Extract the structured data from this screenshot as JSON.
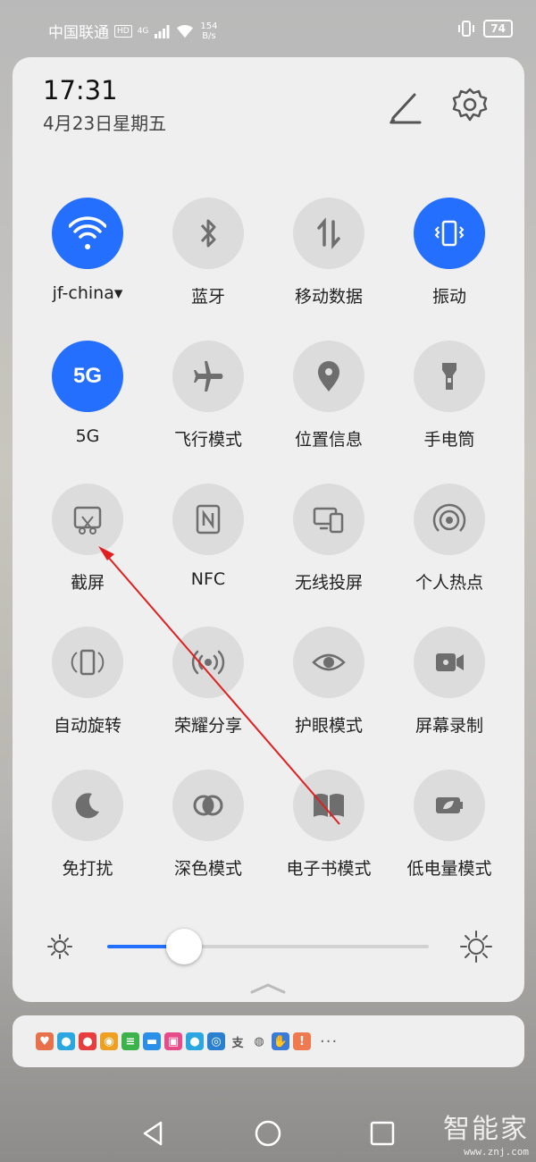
{
  "status_bar": {
    "carrier": "中国联通",
    "hd": "HD",
    "network_type": "4G",
    "net_speed_value": "154",
    "net_speed_unit": "B/s",
    "battery": "74"
  },
  "header": {
    "time": "17:31",
    "date": "4月23日星期五",
    "edit_icon": "pencil-icon",
    "settings_icon": "gear-icon"
  },
  "tiles": [
    {
      "label": "jf-china▾",
      "icon": "wifi-icon",
      "active": true
    },
    {
      "label": "蓝牙",
      "icon": "bluetooth-icon",
      "active": false
    },
    {
      "label": "移动数据",
      "icon": "mobile-data-icon",
      "active": false
    },
    {
      "label": "振动",
      "icon": "vibrate-icon",
      "active": true
    },
    {
      "label": "5G",
      "icon": "5g-icon",
      "icon_text": "5G",
      "active": true
    },
    {
      "label": "飞行模式",
      "icon": "airplane-icon",
      "active": false
    },
    {
      "label": "位置信息",
      "icon": "location-icon",
      "active": false
    },
    {
      "label": "手电筒",
      "icon": "flashlight-icon",
      "active": false
    },
    {
      "label": "截屏",
      "icon": "screenshot-icon",
      "active": false
    },
    {
      "label": "NFC",
      "icon": "nfc-icon",
      "active": false
    },
    {
      "label": "无线投屏",
      "icon": "wireless-projection-icon",
      "active": false
    },
    {
      "label": "个人热点",
      "icon": "hotspot-icon",
      "active": false
    },
    {
      "label": "自动旋转",
      "icon": "auto-rotate-icon",
      "active": false
    },
    {
      "label": "荣耀分享",
      "icon": "honor-share-icon",
      "active": false
    },
    {
      "label": "护眼模式",
      "icon": "eye-comfort-icon",
      "active": false
    },
    {
      "label": "屏幕录制",
      "icon": "screen-record-icon",
      "active": false
    },
    {
      "label": "免打扰",
      "icon": "moon-icon",
      "active": false
    },
    {
      "label": "深色模式",
      "icon": "dark-mode-icon",
      "active": false
    },
    {
      "label": "电子书模式",
      "icon": "ebook-icon",
      "active": false
    },
    {
      "label": "低电量模式",
      "icon": "low-power-icon",
      "active": false
    }
  ],
  "brightness": {
    "level": 0.24
  },
  "colors": {
    "accent": "#256fff",
    "tile_inactive": "#dcdcdc",
    "icon_gray": "#6e6e6e",
    "annotation": "#e02020"
  },
  "notification_icons": [
    "health-icon",
    "browser-icon",
    "app-icon",
    "weibo-icon",
    "app-icon",
    "screen-icon",
    "app-icon",
    "qq-icon",
    "safari-icon",
    "alipay-icon",
    "wechat-icon",
    "hand-icon",
    "cloud-alert-icon"
  ],
  "more_indicator": "···",
  "watermark": {
    "logo": "智能家",
    "url": "www.znj.com"
  }
}
